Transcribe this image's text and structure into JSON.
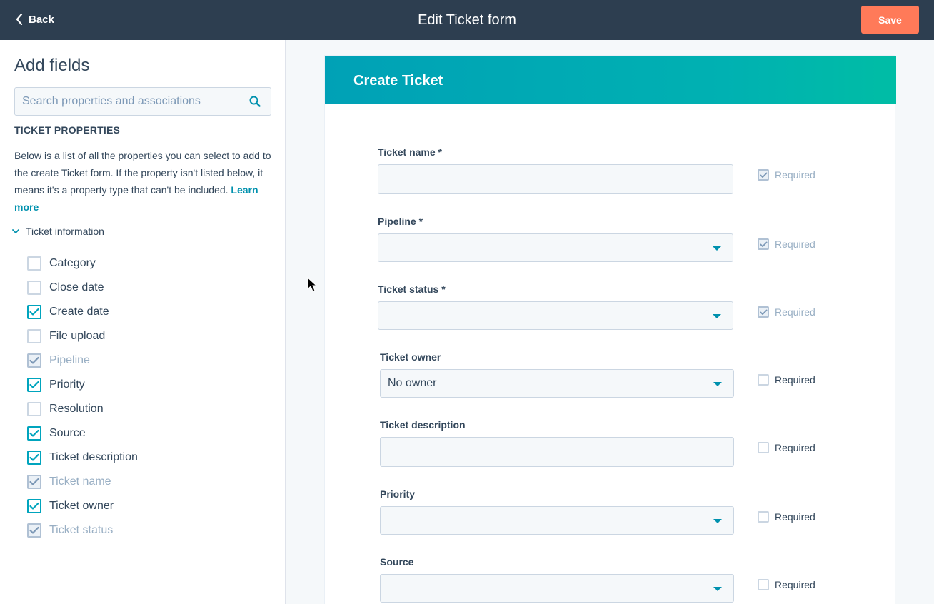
{
  "header": {
    "back_label": "Back",
    "title": "Edit Ticket form",
    "save_label": "Save",
    "bg_color": "#2d3e50",
    "save_color": "#ff7a59"
  },
  "sidebar": {
    "title": "Add fields",
    "search_placeholder": "Search properties and associations",
    "section_heading": "TICKET PROPERTIES",
    "description": "Below is a list of all the properties you can select to add to the create Ticket form. If the property isn't listed below, it means it's a property type that can't be included.",
    "learn_more": "Learn more",
    "group_label": "Ticket information",
    "properties": [
      {
        "label": "Category",
        "checked": false,
        "disabled": false
      },
      {
        "label": "Close date",
        "checked": false,
        "disabled": false
      },
      {
        "label": "Create date",
        "checked": true,
        "disabled": false
      },
      {
        "label": "File upload",
        "checked": false,
        "disabled": false
      },
      {
        "label": "Pipeline",
        "checked": true,
        "disabled": true
      },
      {
        "label": "Priority",
        "checked": true,
        "disabled": false
      },
      {
        "label": "Resolution",
        "checked": false,
        "disabled": false
      },
      {
        "label": "Source",
        "checked": true,
        "disabled": false
      },
      {
        "label": "Ticket description",
        "checked": true,
        "disabled": false
      },
      {
        "label": "Ticket name",
        "checked": true,
        "disabled": true
      },
      {
        "label": "Ticket owner",
        "checked": true,
        "disabled": false
      },
      {
        "label": "Ticket status",
        "checked": true,
        "disabled": true
      }
    ]
  },
  "form": {
    "title": "Create Ticket",
    "required_label": "Required",
    "accent_color": "#00a4bd",
    "fields": [
      {
        "label": "Ticket name *",
        "type": "text",
        "value": "",
        "required": true,
        "required_locked": true
      },
      {
        "label": "Pipeline *",
        "type": "select",
        "value": "",
        "required": true,
        "required_locked": true
      },
      {
        "label": "Ticket status *",
        "type": "select",
        "value": "",
        "required": true,
        "required_locked": true
      },
      {
        "label": "Ticket owner",
        "type": "select",
        "value": "No owner",
        "required": false,
        "required_locked": false
      },
      {
        "label": "Ticket description",
        "type": "text",
        "value": "",
        "required": false,
        "required_locked": false
      },
      {
        "label": "Priority",
        "type": "select",
        "value": "",
        "required": false,
        "required_locked": false
      },
      {
        "label": "Source",
        "type": "select",
        "value": "",
        "required": false,
        "required_locked": false
      }
    ]
  }
}
